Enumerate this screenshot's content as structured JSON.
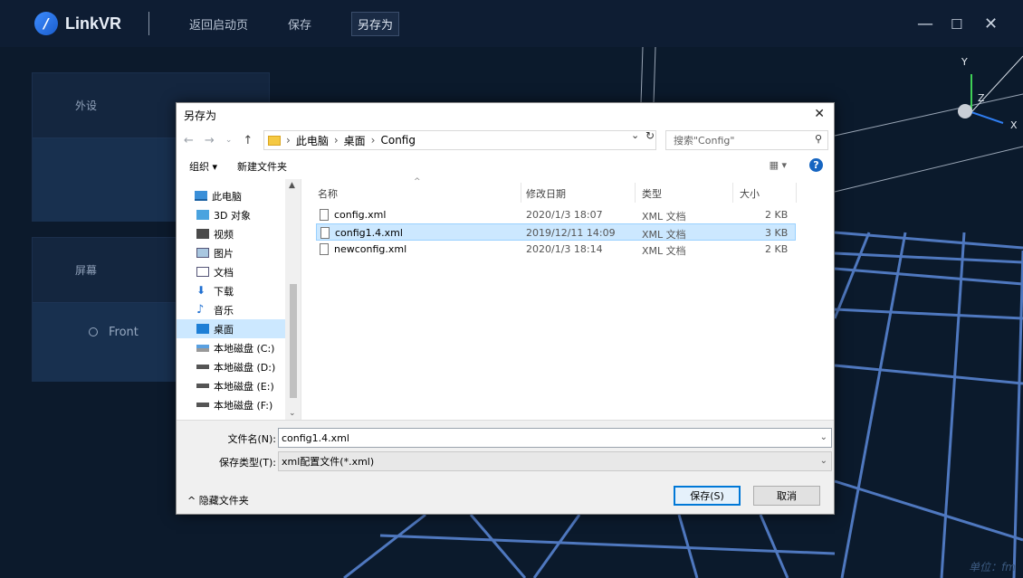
{
  "app": {
    "logo_text": "LinkVR",
    "nav": [
      "返回启动页",
      "保存",
      "另存为"
    ],
    "window_controls": [
      "—",
      "☐",
      "✕"
    ]
  },
  "left_panel": {
    "peripheral_title": "外设",
    "screen_title": "屏幕",
    "screen_option": "Front"
  },
  "viewport": {
    "axes": {
      "y": "Y",
      "z": "Z",
      "x": "X"
    },
    "unit_label": "单位：fm"
  },
  "dialog": {
    "title": "另存为",
    "address": {
      "crumbs": [
        "此电脑",
        "桌面",
        "Config"
      ]
    },
    "search_placeholder": "搜索\"Config\"",
    "toolbar": {
      "organize": "组织 ▾",
      "new_folder": "新建文件夹"
    },
    "nav_items": [
      {
        "label": "此电脑",
        "icon": "pc-icon",
        "level": "root"
      },
      {
        "label": "3D 对象",
        "icon": "3d-objects-icon",
        "level": "child"
      },
      {
        "label": "视频",
        "icon": "video-icon",
        "level": "child"
      },
      {
        "label": "图片",
        "icon": "pictures-icon",
        "level": "child"
      },
      {
        "label": "文档",
        "icon": "documents-icon",
        "level": "child"
      },
      {
        "label": "下载",
        "icon": "download-icon",
        "level": "child"
      },
      {
        "label": "音乐",
        "icon": "music-icon",
        "level": "child"
      },
      {
        "label": "桌面",
        "icon": "desktop-icon",
        "level": "child",
        "selected": true
      },
      {
        "label": "本地磁盘 (C:)",
        "icon": "drive-c-icon",
        "level": "child"
      },
      {
        "label": "本地磁盘 (D:)",
        "icon": "drive-icon",
        "level": "child"
      },
      {
        "label": "本地磁盘 (E:)",
        "icon": "drive-icon",
        "level": "child"
      },
      {
        "label": "本地磁盘 (F:)",
        "icon": "drive-icon",
        "level": "child"
      }
    ],
    "columns": {
      "name": "名称",
      "modified": "修改日期",
      "type": "类型",
      "size": "大小"
    },
    "files": [
      {
        "name": "config.xml",
        "modified": "2020/1/3 18:07",
        "type": "XML 文档",
        "size": "2 KB"
      },
      {
        "name": "config1.4.xml",
        "modified": "2019/12/11 14:09",
        "type": "XML 文档",
        "size": "3 KB",
        "selected": true
      },
      {
        "name": "newconfig.xml",
        "modified": "2020/1/3 18:14",
        "type": "XML 文档",
        "size": "2 KB"
      }
    ],
    "filename_label": "文件名(N):",
    "filename_value": "config1.4.xml",
    "filetype_label": "保存类型(T):",
    "filetype_value": "xml配置文件(*.xml)",
    "hide_folders": "^ 隐藏文件夹",
    "save_button": "保存(S)",
    "cancel_button": "取消"
  }
}
